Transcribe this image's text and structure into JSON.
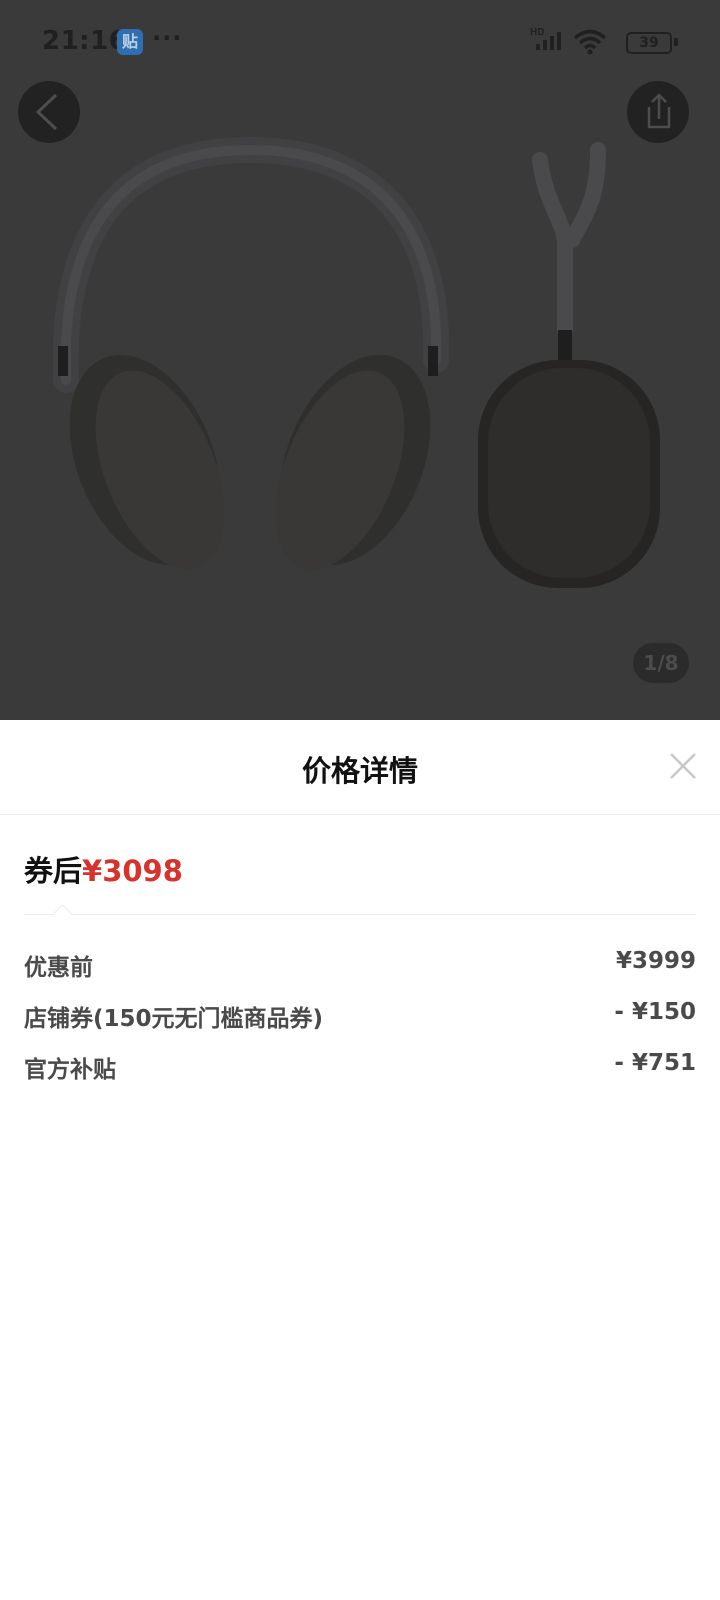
{
  "status_bar": {
    "time": "21:16",
    "app_icon_char": "贴",
    "more": "···",
    "network": "HD",
    "battery": "39"
  },
  "gallery": {
    "counter": "1/8"
  },
  "sheet": {
    "title": "价格详情",
    "final_label": "券后",
    "final_amount": "¥3098",
    "rows": [
      {
        "label": "优惠前",
        "value": "¥3999"
      },
      {
        "label": "店铺券(150元无门槛商品券)",
        "value": "- ¥150"
      },
      {
        "label": "官方补贴",
        "value": "- ¥751"
      }
    ]
  },
  "colors": {
    "accent_red": "#d8322d",
    "overlay": "#3a3a3b"
  }
}
